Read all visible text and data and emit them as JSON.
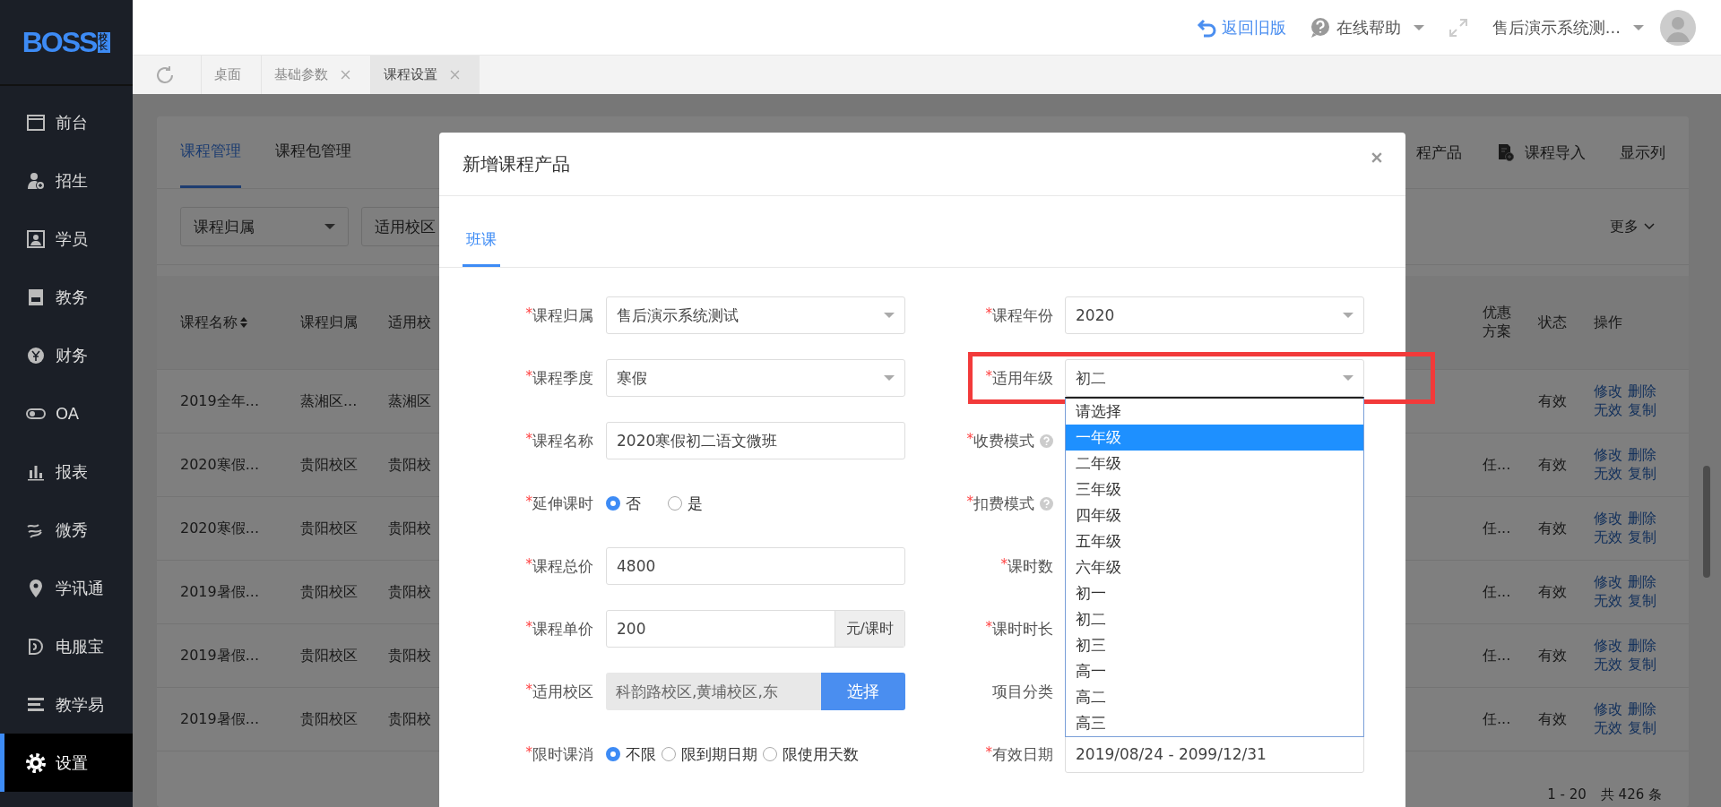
{
  "logo": {
    "wordmark": "BOSS",
    "badge": "校长"
  },
  "sidebar": {
    "items": [
      {
        "label": "前台",
        "selected": false
      },
      {
        "label": "招生",
        "selected": false
      },
      {
        "label": "学员",
        "selected": false
      },
      {
        "label": "教务",
        "selected": false
      },
      {
        "label": "财务",
        "selected": false
      },
      {
        "label": "OA",
        "selected": false
      },
      {
        "label": "报表",
        "selected": false
      },
      {
        "label": "微秀",
        "selected": false
      },
      {
        "label": "学讯通",
        "selected": false
      },
      {
        "label": "电服宝",
        "selected": false
      },
      {
        "label": "教学易",
        "selected": false
      },
      {
        "label": "设置",
        "selected": true
      }
    ]
  },
  "header": {
    "back_link": "返回旧版",
    "help": "在线帮助",
    "account": "售后演示系统测..."
  },
  "page_tabs": [
    {
      "label": "桌面",
      "closable": false,
      "selected": false
    },
    {
      "label": "基础参数",
      "closable": true,
      "selected": false
    },
    {
      "label": "课程设置",
      "closable": true,
      "selected": true
    }
  ],
  "background": {
    "tabs": [
      {
        "label": "课程管理",
        "selected": true
      },
      {
        "label": "课程包管理",
        "selected": false
      }
    ],
    "toolbar": [
      {
        "kind": "text",
        "label": "程产品"
      },
      {
        "kind": "import",
        "label": "课程导入"
      },
      {
        "kind": "text",
        "label": "显示列"
      }
    ],
    "filters": [
      "课程归属",
      "适用校区"
    ],
    "more": "更多",
    "table": {
      "left_columns": [
        {
          "label": "课程名称",
          "sortable": true
        },
        {
          "label": "课程归属",
          "sortable": false
        },
        {
          "label": "适用校",
          "sortable": false
        }
      ],
      "right_columns": [
        "优惠方案",
        "状态",
        "操作"
      ],
      "rows": [
        {
          "name": "2019全年...",
          "owner": "蒸湘区...",
          "campus": "蒸湘区",
          "status": "有效",
          "actions": [
            "修改",
            "删除",
            "无效",
            "复制"
          ]
        },
        {
          "name": "2020寒假...",
          "owner": "贵阳校区",
          "campus": "贵阳校",
          "discount": "任...",
          "status": "有效",
          "actions": [
            "修改",
            "删除",
            "无效",
            "复制"
          ]
        },
        {
          "name": "2020寒假...",
          "owner": "贵阳校区",
          "campus": "贵阳校",
          "discount": "任...",
          "status": "有效",
          "actions": [
            "修改",
            "删除",
            "无效",
            "复制"
          ]
        },
        {
          "name": "2019暑假...",
          "owner": "贵阳校区",
          "campus": "贵阳校",
          "discount": "任...",
          "status": "有效",
          "actions": [
            "修改",
            "删除",
            "无效",
            "复制"
          ]
        },
        {
          "name": "2019暑假...",
          "owner": "贵阳校区",
          "campus": "贵阳校",
          "discount": "任...",
          "status": "有效",
          "actions": [
            "修改",
            "删除",
            "无效",
            "复制"
          ]
        },
        {
          "name": "2019暑假...",
          "owner": "贵阳校区",
          "campus": "贵阳校",
          "discount": "任...",
          "status": "有效",
          "actions": [
            "修改",
            "删除",
            "无效",
            "复制"
          ]
        }
      ]
    },
    "pagination": {
      "range": "1 - 20",
      "total": "共 426 条"
    }
  },
  "dialog": {
    "title": "新增课程产品",
    "tabs": [
      {
        "label": "班课",
        "selected": true
      }
    ],
    "left": [
      {
        "asterisk": "*",
        "label": "课程归属",
        "kind": "select",
        "value": "售后演示系统测试"
      },
      {
        "asterisk": "*",
        "label": "课程季度",
        "kind": "select",
        "value": "寒假"
      },
      {
        "asterisk": "*",
        "label": "课程名称",
        "kind": "input",
        "value": "2020寒假初二语文微班"
      },
      {
        "asterisk": "*",
        "label": "延伸课时",
        "kind": "radio",
        "options": [
          {
            "label": "否",
            "selected": true
          },
          {
            "label": "是",
            "selected": false
          }
        ]
      },
      {
        "asterisk": "*",
        "label": "课程总价",
        "kind": "input",
        "value": "4800"
      },
      {
        "asterisk": "*",
        "label": "课程单价",
        "kind": "addon",
        "value": "200",
        "addon": "元/课时"
      },
      {
        "asterisk": "*",
        "label": "适用校区",
        "kind": "picker",
        "value": "科韵路校区,黄埔校区,东",
        "button": "选择"
      },
      {
        "asterisk": "*",
        "label": "限时课消",
        "kind": "radio",
        "options": [
          {
            "label": "不限",
            "selected": true
          },
          {
            "label": "限到期日期",
            "selected": false
          },
          {
            "label": "限使用天数",
            "selected": false
          }
        ]
      }
    ],
    "right": [
      {
        "asterisk": "*",
        "label": "课程年份",
        "kind": "select",
        "value": "2020"
      },
      {
        "asterisk": "*",
        "label": "适用年级",
        "kind": "select",
        "value": "初二",
        "marked": true,
        "options": [
          {
            "label": "请选择",
            "highlighted": false
          },
          {
            "label": "一年级",
            "highlighted": true
          },
          {
            "label": "二年级",
            "highlighted": false
          },
          {
            "label": "三年级",
            "highlighted": false
          },
          {
            "label": "四年级",
            "highlighted": false
          },
          {
            "label": "五年级",
            "highlighted": false
          },
          {
            "label": "六年级",
            "highlighted": false
          },
          {
            "label": "初一",
            "highlighted": false
          },
          {
            "label": "初二",
            "highlighted": false
          },
          {
            "label": "初三",
            "highlighted": false
          },
          {
            "label": "高一",
            "highlighted": false
          },
          {
            "label": "高二",
            "highlighted": false
          },
          {
            "label": "高三",
            "highlighted": false
          }
        ]
      },
      {
        "asterisk": "*",
        "label": "收费模式",
        "help": true,
        "kind": "covered"
      },
      {
        "asterisk": "*",
        "label": "扣费模式",
        "help": true,
        "kind": "covered"
      },
      {
        "asterisk": "*",
        "label": "课时数",
        "kind": "covered"
      },
      {
        "asterisk": "*",
        "label": "课时时长",
        "kind": "covered"
      },
      {
        "label": "项目分类",
        "kind": "covered"
      },
      {
        "asterisk": "*",
        "label": "有效日期",
        "kind": "input",
        "value": "2019/08/24 - 2099/12/31"
      }
    ]
  }
}
